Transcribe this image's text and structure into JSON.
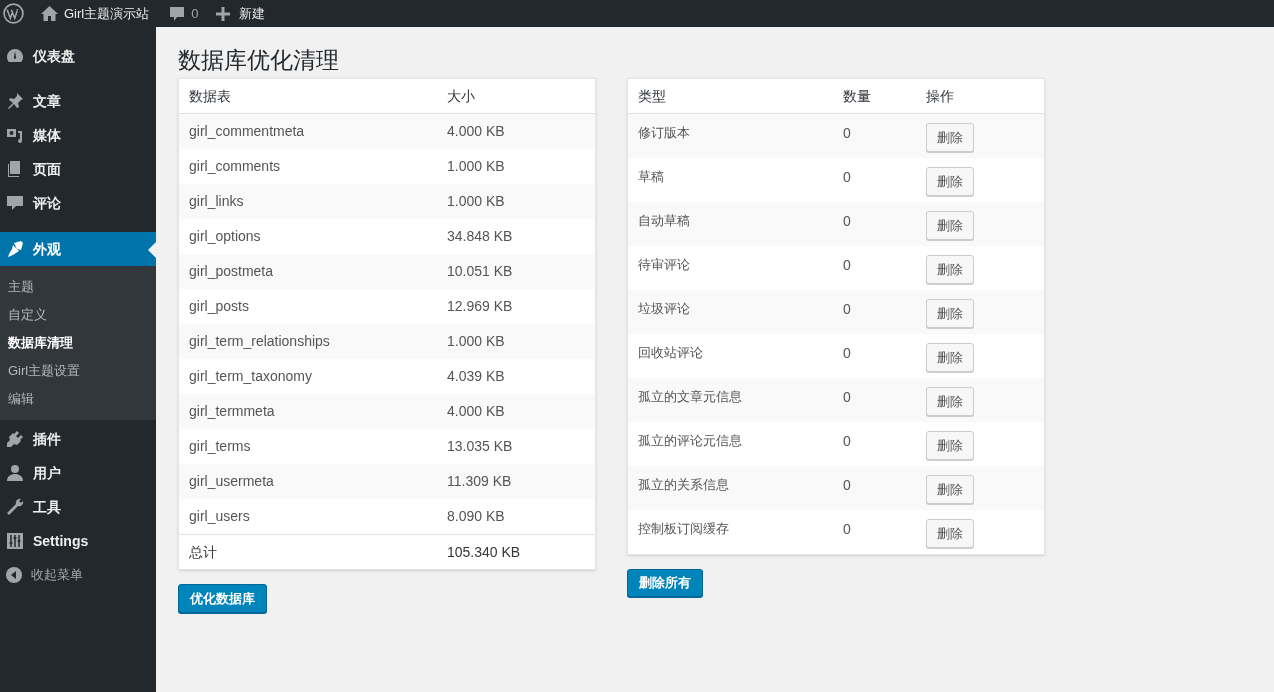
{
  "admin_bar": {
    "site_name": "Girl主题演示站",
    "comments_count": "0",
    "new_label": "新建"
  },
  "sidebar": {
    "items": [
      {
        "label": "仪表盘",
        "selected": false
      },
      {
        "label": "文章",
        "selected": false
      },
      {
        "label": "媒体",
        "selected": false
      },
      {
        "label": "页面",
        "selected": false
      },
      {
        "label": "评论",
        "selected": false
      },
      {
        "label": "外观",
        "selected": true,
        "children": [
          {
            "label": "主题",
            "selected": false
          },
          {
            "label": "自定义",
            "selected": false
          },
          {
            "label": "数据库清理",
            "selected": true
          },
          {
            "label": "Girl主题设置",
            "selected": false
          },
          {
            "label": "编辑",
            "selected": false
          }
        ]
      },
      {
        "label": "插件",
        "selected": false
      },
      {
        "label": "用户",
        "selected": false
      },
      {
        "label": "工具",
        "selected": false
      },
      {
        "label": "Settings",
        "selected": false
      }
    ],
    "collapse_label": "收起菜单"
  },
  "page_title": "数据库优化清理",
  "tables_table": {
    "columns": [
      "数据表",
      "大小"
    ],
    "rows": [
      [
        "girl_commentmeta",
        "4.000 KB"
      ],
      [
        "girl_comments",
        "1.000 KB"
      ],
      [
        "girl_links",
        "1.000 KB"
      ],
      [
        "girl_options",
        "34.848 KB"
      ],
      [
        "girl_postmeta",
        "10.051 KB"
      ],
      [
        "girl_posts",
        "12.969 KB"
      ],
      [
        "girl_term_relationships",
        "1.000 KB"
      ],
      [
        "girl_term_taxonomy",
        "4.039 KB"
      ],
      [
        "girl_termmeta",
        "4.000 KB"
      ],
      [
        "girl_terms",
        "13.035 KB"
      ],
      [
        "girl_usermeta",
        "11.309 KB"
      ],
      [
        "girl_users",
        "8.090 KB"
      ]
    ],
    "footer": [
      "总计",
      "105.340 KB"
    ],
    "button": "优化数据库"
  },
  "cleanup_table": {
    "columns": [
      "类型",
      "数量",
      "操作"
    ],
    "rows": [
      {
        "type": "修订版本",
        "count": "0",
        "action": "删除"
      },
      {
        "type": "草稿",
        "count": "0",
        "action": "删除"
      },
      {
        "type": "自动草稿",
        "count": "0",
        "action": "删除"
      },
      {
        "type": "待审评论",
        "count": "0",
        "action": "删除"
      },
      {
        "type": "垃圾评论",
        "count": "0",
        "action": "删除"
      },
      {
        "type": "回收站评论",
        "count": "0",
        "action": "删除"
      },
      {
        "type": "孤立的文章元信息",
        "count": "0",
        "action": "删除"
      },
      {
        "type": "孤立的评论元信息",
        "count": "0",
        "action": "删除"
      },
      {
        "type": "孤立的关系信息",
        "count": "0",
        "action": "删除"
      },
      {
        "type": "控制板订阅缓存",
        "count": "0",
        "action": "删除"
      }
    ],
    "button": "删除所有"
  }
}
